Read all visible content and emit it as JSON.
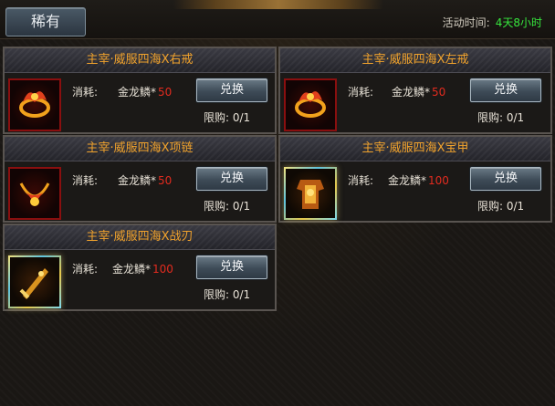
{
  "header": {
    "tab_label": "稀有",
    "event_time_label": "活动时间:",
    "event_time_value": "4天8小时"
  },
  "cards": [
    {
      "title": "主宰·威服四海Ⅹ右戒",
      "cost_label": "消耗:",
      "cost_item": "金龙鳞*",
      "cost_value": "50",
      "button_label": "兑换",
      "limit": "限购: 0/1",
      "item_icon": "ring-icon"
    },
    {
      "title": "主宰·威服四海Ⅹ左戒",
      "cost_label": "消耗:",
      "cost_item": "金龙鳞*",
      "cost_value": "50",
      "button_label": "兑换",
      "limit": "限购: 0/1",
      "item_icon": "ring-icon"
    },
    {
      "title": "主宰·威服四海Ⅹ项链",
      "cost_label": "消耗:",
      "cost_item": "金龙鳞*",
      "cost_value": "50",
      "button_label": "兑换",
      "limit": "限购: 0/1",
      "item_icon": "necklace-icon"
    },
    {
      "title": "主宰·威服四海Ⅹ宝甲",
      "cost_label": "消耗:",
      "cost_item": "金龙鳞*",
      "cost_value": "100",
      "button_label": "兑换",
      "limit": "限购: 0/1",
      "item_icon": "armor-icon"
    },
    {
      "title": "主宰·威服四海Ⅹ战刃",
      "cost_label": "消耗:",
      "cost_item": "金龙鳞*",
      "cost_value": "100",
      "button_label": "兑换",
      "limit": "限购: 0/1",
      "item_icon": "blade-icon"
    }
  ],
  "colors": {
    "title_orange": "#f0a22c",
    "cost_red": "#e32b1f",
    "time_green": "#37e63d"
  }
}
